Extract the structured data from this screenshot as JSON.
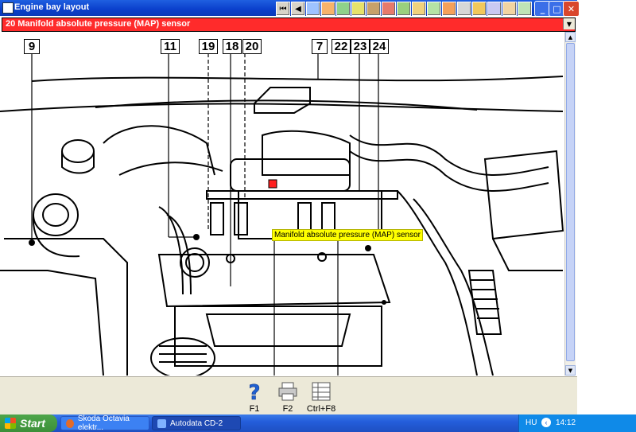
{
  "window": {
    "title": "Engine bay layout"
  },
  "toolbar_icons": [
    "first-icon",
    "prev-icon",
    "tool-icon-1",
    "tool-icon-2",
    "tool-icon-3",
    "tool-icon-4",
    "tool-icon-5",
    "tool-icon-6",
    "tool-icon-7",
    "tool-icon-8",
    "tool-icon-9",
    "tool-icon-10",
    "tool-icon-11",
    "tool-icon-12",
    "tool-icon-13",
    "tool-icon-14"
  ],
  "component_select": {
    "value": "20  Manifold absolute pressure (MAP) sensor"
  },
  "diagram": {
    "callouts": [
      "9",
      "11",
      "19",
      "18",
      "20",
      "7",
      "22",
      "23",
      "24"
    ],
    "tooltip": "Manifold absolute pressure (MAP) sensor"
  },
  "bottom_toolbar": {
    "f1_label": "F1",
    "f2_label": "F2",
    "ctrlf8_label": "Ctrl+F8"
  },
  "taskbar": {
    "start_label": "Start",
    "tasks": [
      "Skoda Octavia elektr...",
      "Autodata CD-2"
    ],
    "language": "HU",
    "time": "14:12"
  },
  "colors": {
    "selector_bg": "#ff2b2b",
    "tooltip_bg": "#ffff00",
    "titlebar": "#0a3fcb"
  }
}
